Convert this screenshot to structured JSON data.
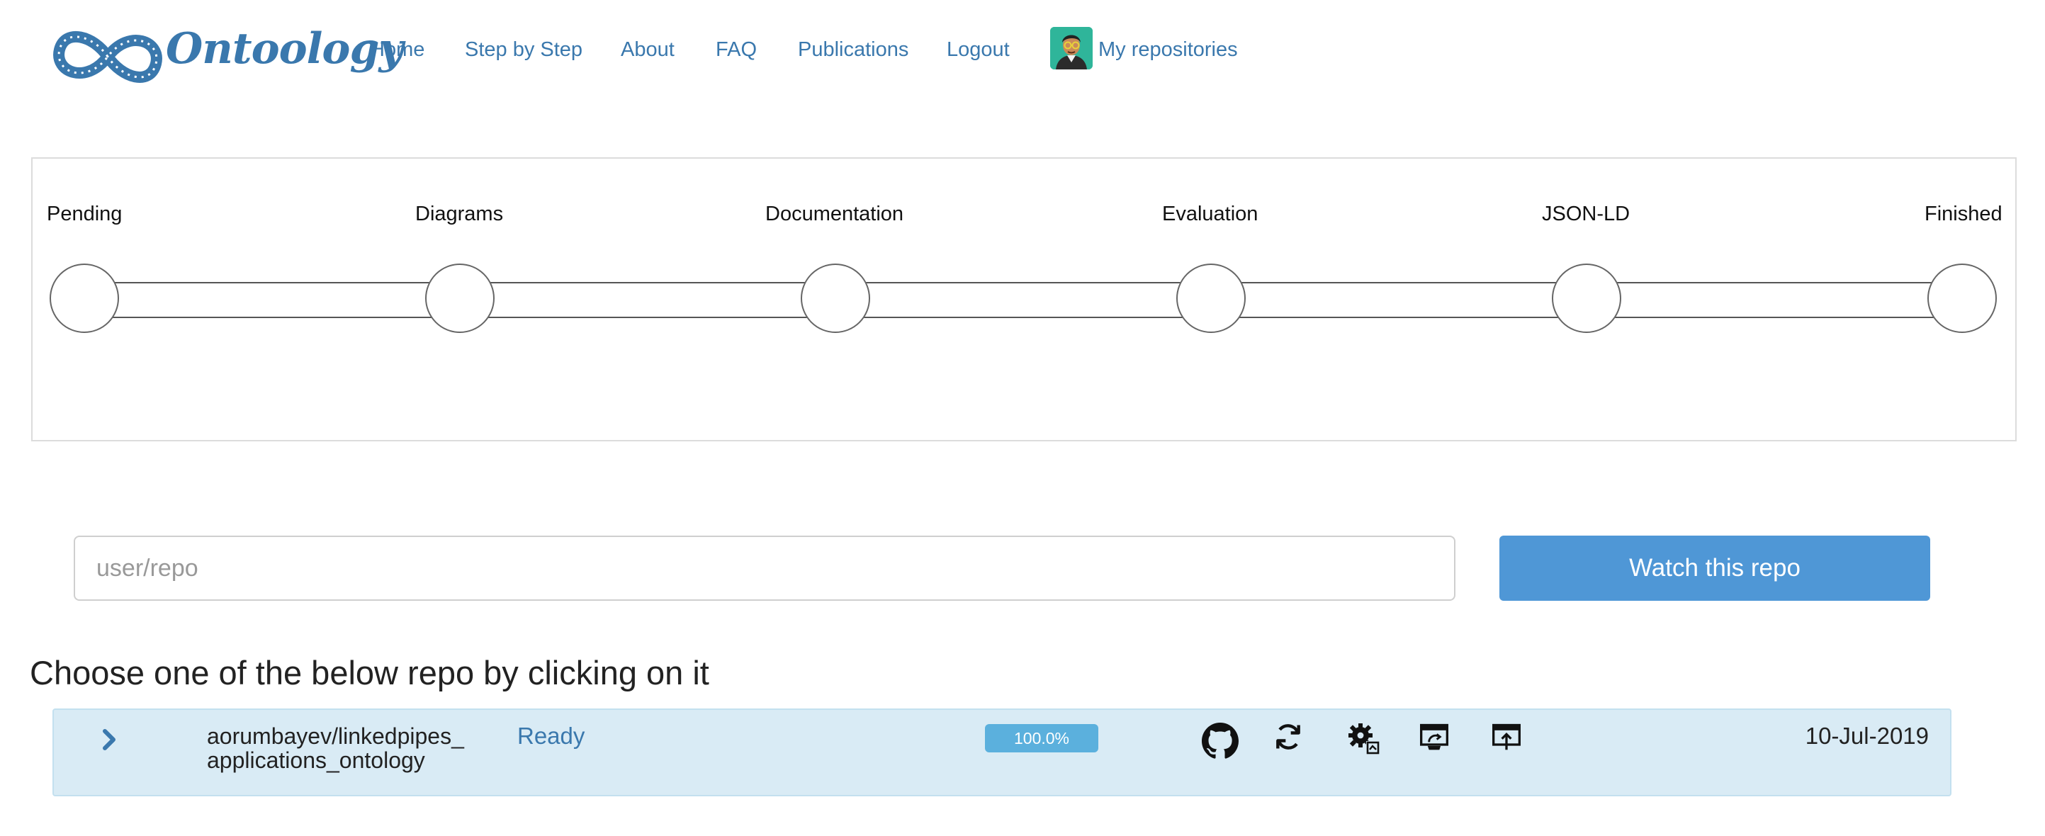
{
  "brand": {
    "name": "Ontoology"
  },
  "nav": {
    "items": [
      {
        "label": "Home"
      },
      {
        "label": "Step by Step"
      },
      {
        "label": "About"
      },
      {
        "label": "FAQ"
      },
      {
        "label": "Publications"
      },
      {
        "label": "Logout"
      }
    ],
    "repos_label": "My repositories"
  },
  "stepper": {
    "steps": [
      {
        "label": "Pending"
      },
      {
        "label": "Diagrams"
      },
      {
        "label": "Documentation"
      },
      {
        "label": "Evaluation"
      },
      {
        "label": "JSON-LD"
      },
      {
        "label": "Finished"
      }
    ]
  },
  "watch": {
    "placeholder": "user/repo",
    "button_label": "Watch this repo"
  },
  "repos": {
    "heading": "Choose one of the below repo by clicking on it",
    "rows": [
      {
        "name_line1": "aorumbayev/linkedpipes_",
        "name_line2": "applications_ontology",
        "status": "Ready",
        "progress_label": "100.0%",
        "progress_fraction": 1.0,
        "date": "10-Jul-2019",
        "icons": [
          "github-icon",
          "refresh-icon",
          "settings-icon",
          "publish-icon",
          "upload-icon"
        ]
      }
    ]
  },
  "colors": {
    "link": "#3a78ad",
    "button": "#4f97d6",
    "row_bg": "#d9ebf5",
    "progress": "#5bb0dd"
  }
}
